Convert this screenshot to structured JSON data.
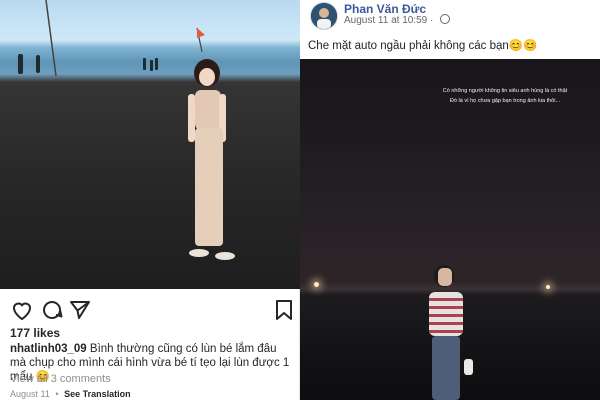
{
  "instagram": {
    "likes": "177 likes",
    "username": "nhatlinh03_09",
    "caption": "Bình thường cũng có lùn bé lắm đâu mà chụp cho mình cái hình vừa bé tí tẹo lại lùn được 1 mẩu 😊",
    "view_comments": "View all 3 comments",
    "date": "August 11",
    "separator": "•",
    "see_translation": "See Translation"
  },
  "facebook": {
    "name": "Phan Văn Đức",
    "date": "August 11 at 10:59",
    "dot": "·",
    "post_text": "Che mặt auto ngầu phải không các bạn😊😊",
    "overlay_line1": "Có những người không tin siêu anh hùng là có thật",
    "overlay_line2": "Đó là vì họ chưa gặp bạn trong ảnh kia thôi..."
  },
  "icons": [
    "heart-icon",
    "comment-icon",
    "share-icon",
    "bookmark-icon",
    "globe-icon"
  ]
}
